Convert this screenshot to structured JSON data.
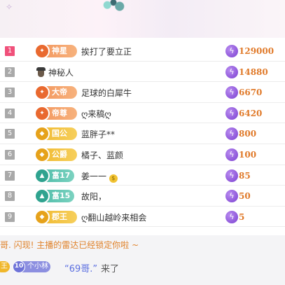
{
  "ranking": [
    {
      "rank": "1",
      "badge": "神星",
      "badge_style": "orange",
      "badge_icon": "✦",
      "name": "挨打了要立正",
      "score": "129000"
    },
    {
      "rank": "2",
      "badge": "",
      "badge_style": "none",
      "badge_icon": "",
      "name": "神秘人",
      "score": "14880"
    },
    {
      "rank": "3",
      "badge": "大帝",
      "badge_style": "orange",
      "badge_icon": "✦",
      "name": "足球的白犀牛",
      "score": "6670"
    },
    {
      "rank": "4",
      "badge": "帝尊",
      "badge_style": "orange",
      "badge_icon": "✦",
      "name": "ღ来稿ღ",
      "score": "6420"
    },
    {
      "rank": "5",
      "badge": "国公",
      "badge_style": "gold",
      "badge_icon": "◆",
      "name": "蓝胖子**",
      "score": "800"
    },
    {
      "rank": "6",
      "badge": "公爵",
      "badge_style": "gold",
      "badge_icon": "◆",
      "name": "橘子、蓝颜",
      "score": "100"
    },
    {
      "rank": "7",
      "badge": "富17",
      "badge_style": "teal",
      "badge_icon": "▲",
      "name": "姜一一",
      "score": "85"
    },
    {
      "rank": "8",
      "badge": "富15",
      "badge_style": "teal",
      "badge_icon": "▲",
      "name": "故阳，",
      "score": "50"
    },
    {
      "rank": "9",
      "badge": "郡王",
      "badge_style": "gold",
      "badge_icon": "◆",
      "name": "ღ翻山越岭来相会",
      "score": "5"
    }
  ],
  "chat": {
    "system_message": "哥. 闪现! 主播的雷达已经锁定你啦 ~",
    "enter_message": {
      "cut_badge": "王",
      "fan_level": "10",
      "fan_club": "个小林",
      "user": "“69哥.”",
      "action": "来了"
    }
  },
  "colors": {
    "accent_pink": "#f0507a",
    "score_orange": "#e07a2a",
    "system_orange": "#e0832c",
    "bolt_purple": "#7a3fd0",
    "username_blue": "#5a6ee0"
  },
  "icons": {
    "score": "lightning-bolt-icon",
    "secret_user": "spy-hat-icon",
    "emoji": "money-bag-icon"
  }
}
